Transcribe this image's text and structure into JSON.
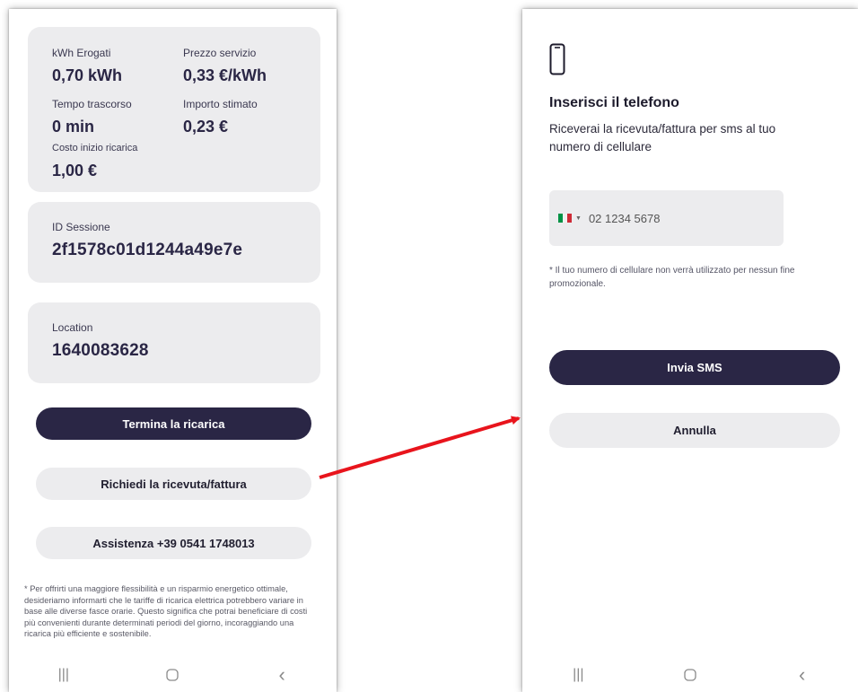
{
  "charging": {
    "kwh_label": "kWh Erogati",
    "kwh_value": "0,70 kWh",
    "price_label": "Prezzo servizio",
    "price_value": "0,33 €/kWh",
    "time_label": "Tempo trascorso",
    "time_value": "0 min",
    "amount_label": "Importo stimato",
    "amount_value": "0,23 €",
    "start_cost_label": "Costo inizio ricarica",
    "start_cost_value": "1,00 €"
  },
  "session": {
    "label": "ID Sessione",
    "value": "2f1578c01d1244a49e7e"
  },
  "location": {
    "label": "Location",
    "value": "1640083628"
  },
  "buttons": {
    "stop_charge": "Termina la ricarica",
    "request_receipt": "Richiedi la ricevuta/fattura",
    "assistance": "Assistenza +39 0541 1748013"
  },
  "tariff_note": "* Per offrirti una maggiore flessibilità e un risparmio energetico ottimale, desideriamo informarti che le tariffe di ricarica elettrica potrebbero variare in base alle diverse fasce orarie. Questo significa che potrai beneficiare di costi più convenienti durante determinati periodi del giorno, incoraggiando una ricarica più efficiente e sostenibile.",
  "phone_dialog": {
    "icon": "smartphone-icon",
    "title": "Inserisci il telefono",
    "description": "Riceverai la ricevuta/fattura per sms al tuo numero di cellulare",
    "phone_placeholder": "02 1234 5678",
    "privacy_note": "* Il tuo numero di cellulare non verrà utilizzato per nessun fine promozionale.",
    "send_label": "Invia SMS",
    "cancel_label": "Annulla"
  },
  "navbar": {
    "recents": "|||",
    "home": "○",
    "back": "‹"
  },
  "colors": {
    "primary": "#2a2645",
    "card": "#ececee",
    "arrow": "#e8141c",
    "flag_green": "#009246",
    "flag_white": "#f1f2f1",
    "flag_red": "#ce2b37"
  }
}
